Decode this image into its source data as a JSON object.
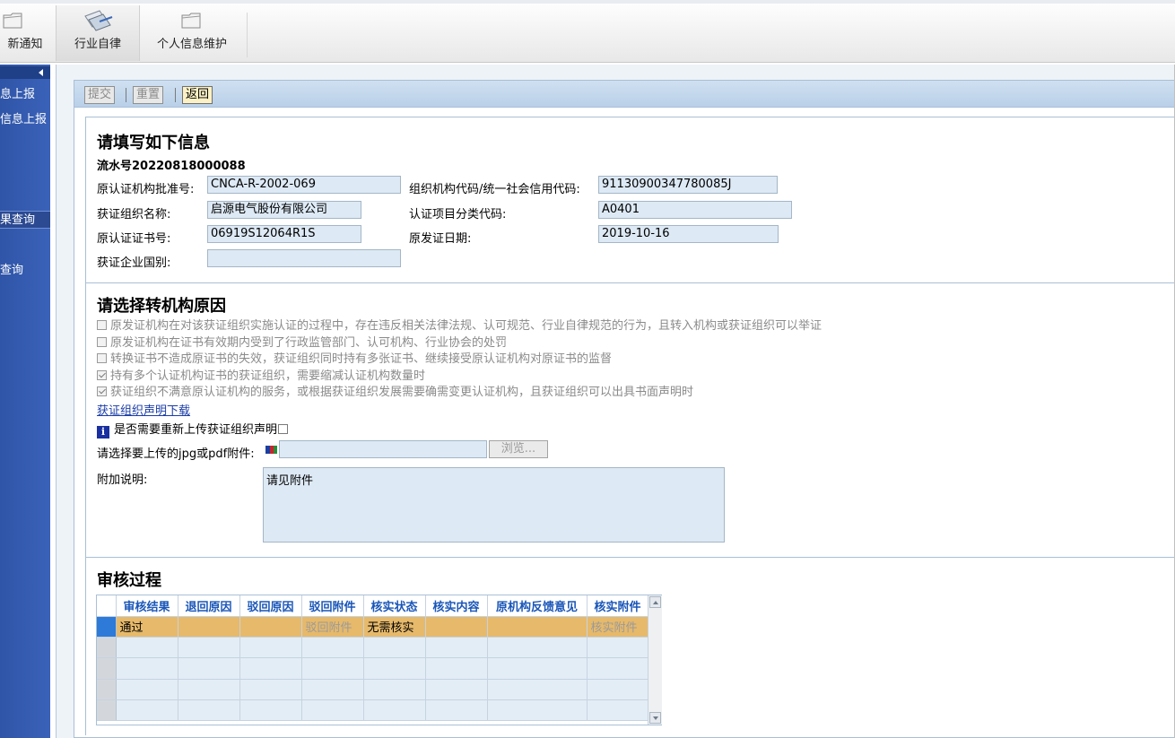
{
  "topbar": {
    "items": [
      {
        "label": "新通知",
        "icon": "folder-icon"
      },
      {
        "label": "行业自律",
        "icon": "papers-icon"
      },
      {
        "label": "个人信息维护",
        "icon": "folder-icon"
      }
    ]
  },
  "sidebar": {
    "items": [
      {
        "label": "息上报"
      },
      {
        "label": "信息上报"
      },
      {
        "label": "果查询"
      },
      {
        "label": "查询"
      }
    ]
  },
  "actions": {
    "submit": "提交",
    "reset": "重置",
    "back": "返回"
  },
  "form": {
    "title": "请填写如下信息",
    "serial": "流水号20220818000088",
    "fields": {
      "orig_approval_no_label": "原认证机构批准号:",
      "orig_approval_no": "CNCA-R-2002-069",
      "org_code_label": "组织机构代码/统一社会信用代码:",
      "org_code": "91130900347780085J",
      "org_name_label": "获证组织名称:",
      "org_name": "启源电气股份有限公司",
      "category_code_label": "认证项目分类代码:",
      "category_code": "A0401",
      "cert_no_label": "原认证证书号:",
      "cert_no": "06919S12064R1S",
      "issue_date_label": "原发证日期:",
      "issue_date": "2019-10-16",
      "country_label": "获证企业国别:",
      "country": ""
    }
  },
  "reasons": {
    "title": "请选择转机构原因",
    "options": [
      {
        "text": "原发证机构在对该获证组织实施认证的过程中，存在违反相关法律法规、认可规范、行业自律规范的行为，且转入机构或获证组织可以举证",
        "checked": false
      },
      {
        "text": "原发证机构在证书有效期内受到了行政监管部门、认可机构、行业协会的处罚",
        "checked": false
      },
      {
        "text": "转换证书不造成原证书的失效，获证组织同时持有多张证书、继续接受原认证机构对原证书的监督",
        "checked": false
      },
      {
        "text": "持有多个认证机构证书的获证组织，需要缩减认证机构数量时",
        "checked": true
      },
      {
        "text": "获证组织不满意原认证机构的服务，或根据获证组织发展需要确需变更认证机构，且获证组织可以出具书面声明时",
        "checked": true
      }
    ],
    "download_link": "获证组织声明下载",
    "reupload_label": "是否需要重新上传获证组织声明",
    "upload_label": "请选择要上传的jpg或pdf附件:",
    "browse": "浏览...",
    "note_label": "附加说明:",
    "note": "请见附件"
  },
  "review": {
    "title": "审核过程",
    "columns": [
      "审核结果",
      "退回原因",
      "驳回原因",
      "驳回附件",
      "核实状态",
      "核实内容",
      "原机构反馈意见",
      "核实附件"
    ],
    "rows": [
      [
        "通过",
        "",
        "",
        "驳回附件",
        "无需核实",
        "",
        "",
        "核实附件"
      ]
    ]
  }
}
